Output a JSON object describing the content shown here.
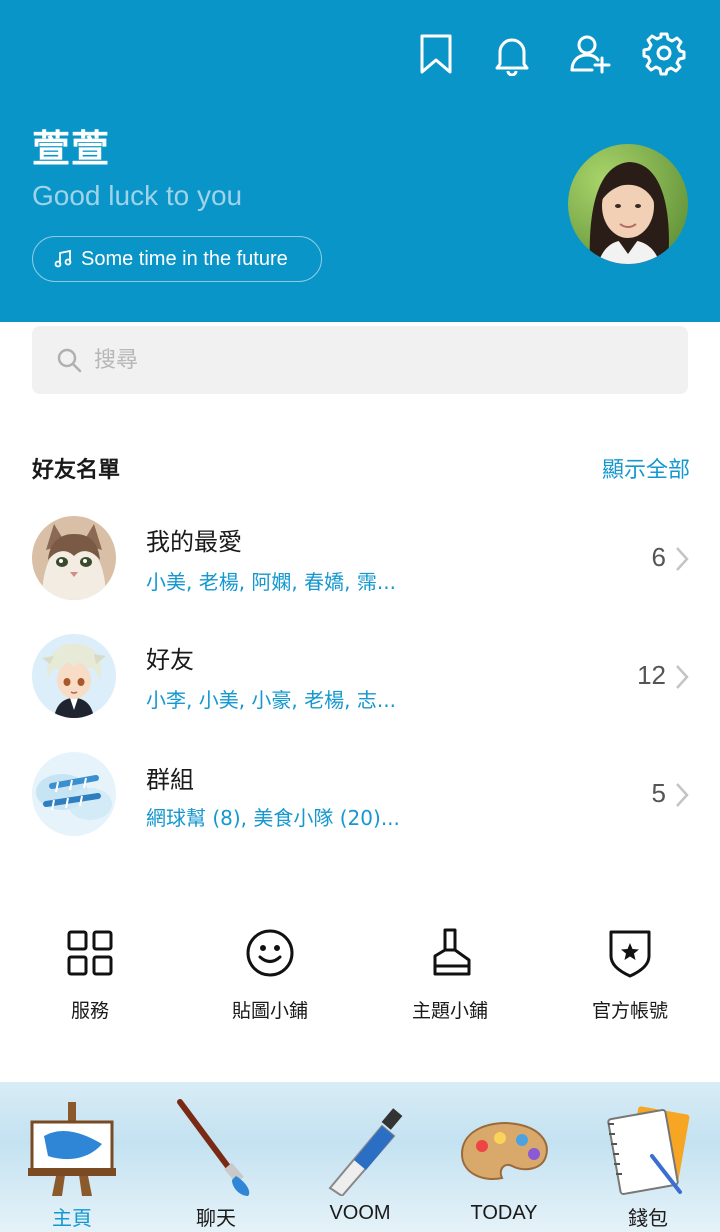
{
  "header": {
    "profile_name": "萱萱",
    "status_message": "Good luck to you",
    "music_title": "Some time in the future",
    "icons": [
      "bookmark-icon",
      "bell-icon",
      "add-friend-icon",
      "gear-icon"
    ]
  },
  "search": {
    "placeholder": "搜尋"
  },
  "friends": {
    "title": "好友名單",
    "show_all": "顯示全部",
    "rows": [
      {
        "title": "我的最愛",
        "members": "小美, 老楊, 阿嫻, 春嬌, 霈...",
        "count": "6"
      },
      {
        "title": "好友",
        "members": "小李, 小美, 小豪, 老楊, 志...",
        "count": "12"
      },
      {
        "title": "群組",
        "members": "網球幫 (8), 美食小隊 (20)...",
        "count": "5"
      }
    ]
  },
  "services": [
    {
      "label": "服務",
      "icon": "grid-icon"
    },
    {
      "label": "貼圖小鋪",
      "icon": "smiley-icon"
    },
    {
      "label": "主題小鋪",
      "icon": "brush-icon"
    },
    {
      "label": "官方帳號",
      "icon": "shield-star-icon"
    }
  ],
  "bottom_nav": [
    {
      "label": "主頁",
      "icon": "easel-icon",
      "active": true
    },
    {
      "label": "聊天",
      "icon": "paintbrush-icon"
    },
    {
      "label": "VOOM",
      "icon": "paint-tube-icon"
    },
    {
      "label": "TODAY",
      "icon": "palette-icon"
    },
    {
      "label": "錢包",
      "icon": "notebook-icon"
    }
  ],
  "colors": {
    "header_bg": "#0a95c8",
    "accent": "#1598cf"
  }
}
